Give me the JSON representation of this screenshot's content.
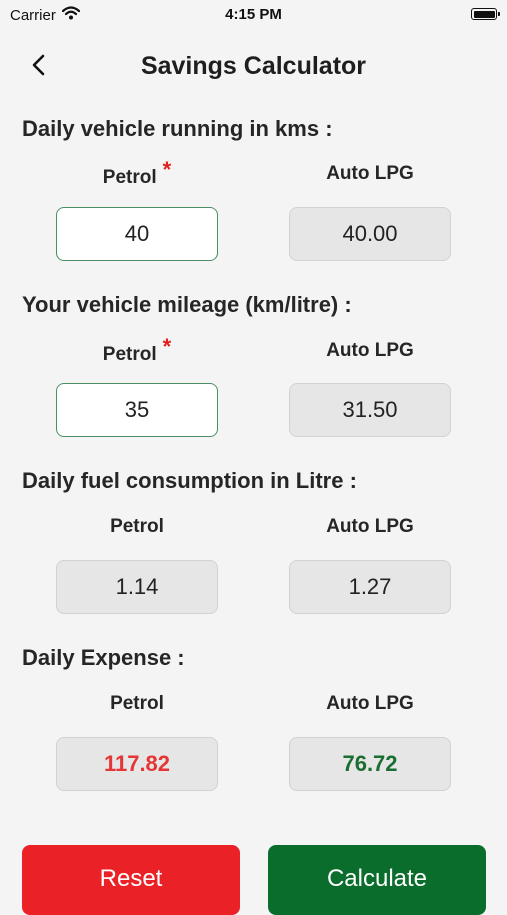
{
  "status": {
    "carrier": "Carrier",
    "time": "4:15 PM"
  },
  "header": {
    "title": "Savings Calculator"
  },
  "required_mark": "*",
  "sections": {
    "running": {
      "heading": "Daily vehicle running in kms :",
      "petrol_label": "Petrol",
      "lpg_label": "Auto LPG",
      "petrol_value": "40",
      "lpg_value": "40.00"
    },
    "mileage": {
      "heading": "Your vehicle mileage (km/litre) :",
      "petrol_label": "Petrol",
      "lpg_label": "Auto LPG",
      "petrol_value": "35",
      "lpg_value": "31.50"
    },
    "consumption": {
      "heading": "Daily fuel consumption in Litre :",
      "petrol_label": "Petrol",
      "lpg_label": "Auto LPG",
      "petrol_value": "1.14",
      "lpg_value": "1.27"
    },
    "expense": {
      "heading": "Daily Expense :",
      "petrol_label": "Petrol",
      "lpg_label": "Auto LPG",
      "petrol_value": "117.82",
      "lpg_value": "76.72"
    }
  },
  "buttons": {
    "reset": "Reset",
    "calculate": "Calculate"
  },
  "colors": {
    "background": "#f4f4f4",
    "input_border": "#4a8e63",
    "readonly_fill": "#e6e6e6",
    "required": "#e02020",
    "expense_petrol": "#e53535",
    "expense_lpg": "#1b6e31",
    "reset_button": "#ea2227",
    "calculate_button": "#0a6d2c"
  }
}
